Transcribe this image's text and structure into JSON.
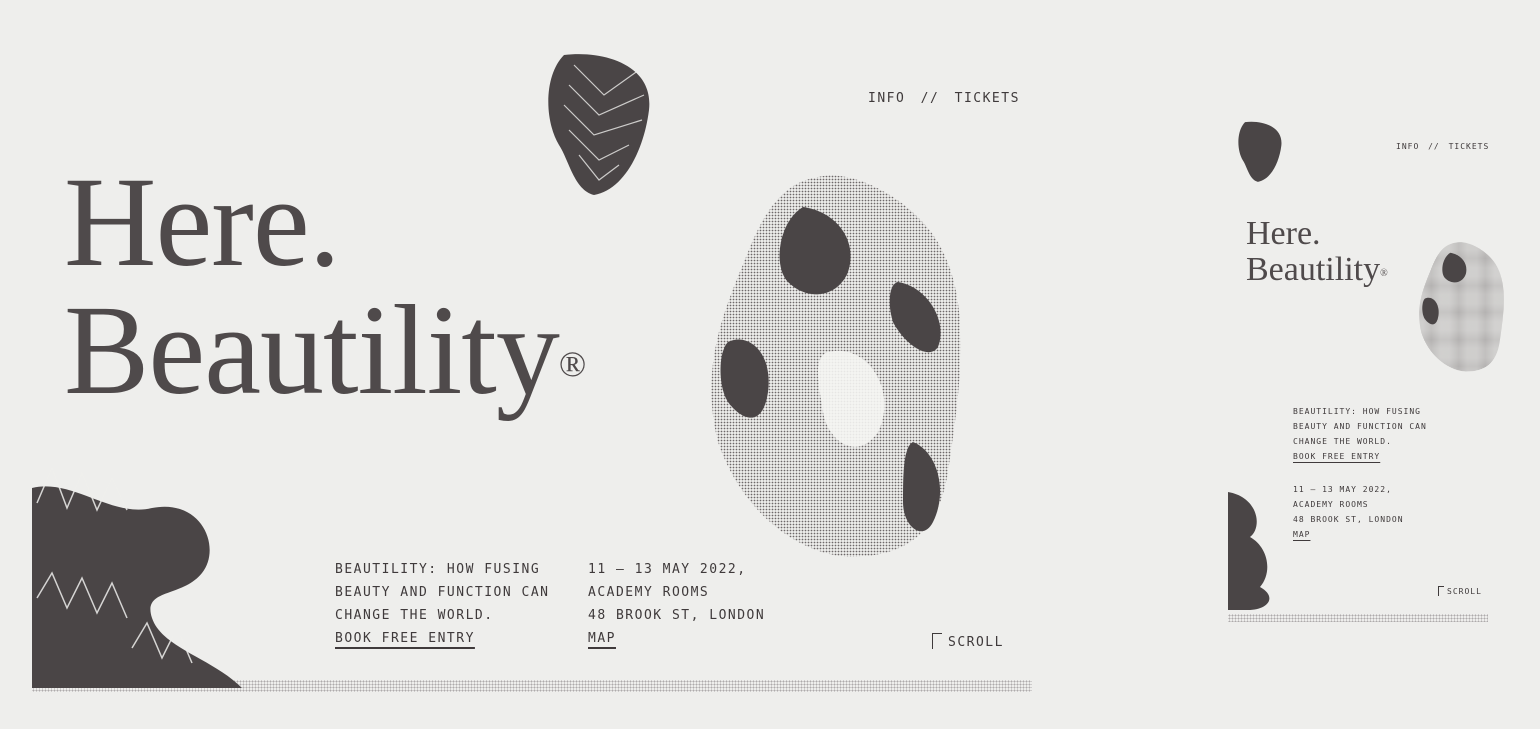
{
  "colors": {
    "background": "#eeeeec",
    "ink": "#4a4546"
  },
  "desktop": {
    "nav": {
      "info": "INFO",
      "separator": "//",
      "tickets": "TICKETS"
    },
    "headline": {
      "line1": "Here.",
      "line2": "Beautility",
      "mark": "®"
    },
    "about": {
      "line1": "BEAUTILITY: HOW FUSING",
      "line2": "BEAUTY AND FUNCTION CAN",
      "line3": "CHANGE THE WORLD.",
      "cta": "BOOK FREE ENTRY"
    },
    "event": {
      "dates": "11 — 13 MAY 2022,",
      "venue": "ACADEMY ROOMS",
      "address": "48 BROOK ST, LONDON",
      "map": "MAP"
    },
    "scroll": "SCROLL",
    "icons": [
      "scroll-arrow-icon"
    ]
  },
  "mobile": {
    "nav": {
      "info": "INFO",
      "separator": "//",
      "tickets": "TICKETS"
    },
    "headline": {
      "line1": "Here.",
      "line2": "Beautility",
      "mark": "®"
    },
    "about": {
      "line1": "BEAUTILITY: HOW FUSING",
      "line2": "BEAUTY AND FUNCTION CAN",
      "line3": "CHANGE THE WORLD.",
      "cta": "BOOK FREE ENTRY"
    },
    "event": {
      "dates": "11 — 13 MAY 2022,",
      "venue": "ACADEMY ROOMS",
      "address": "48 BROOK ST, LONDON",
      "map": "MAP"
    },
    "scroll": "SCROLL"
  }
}
